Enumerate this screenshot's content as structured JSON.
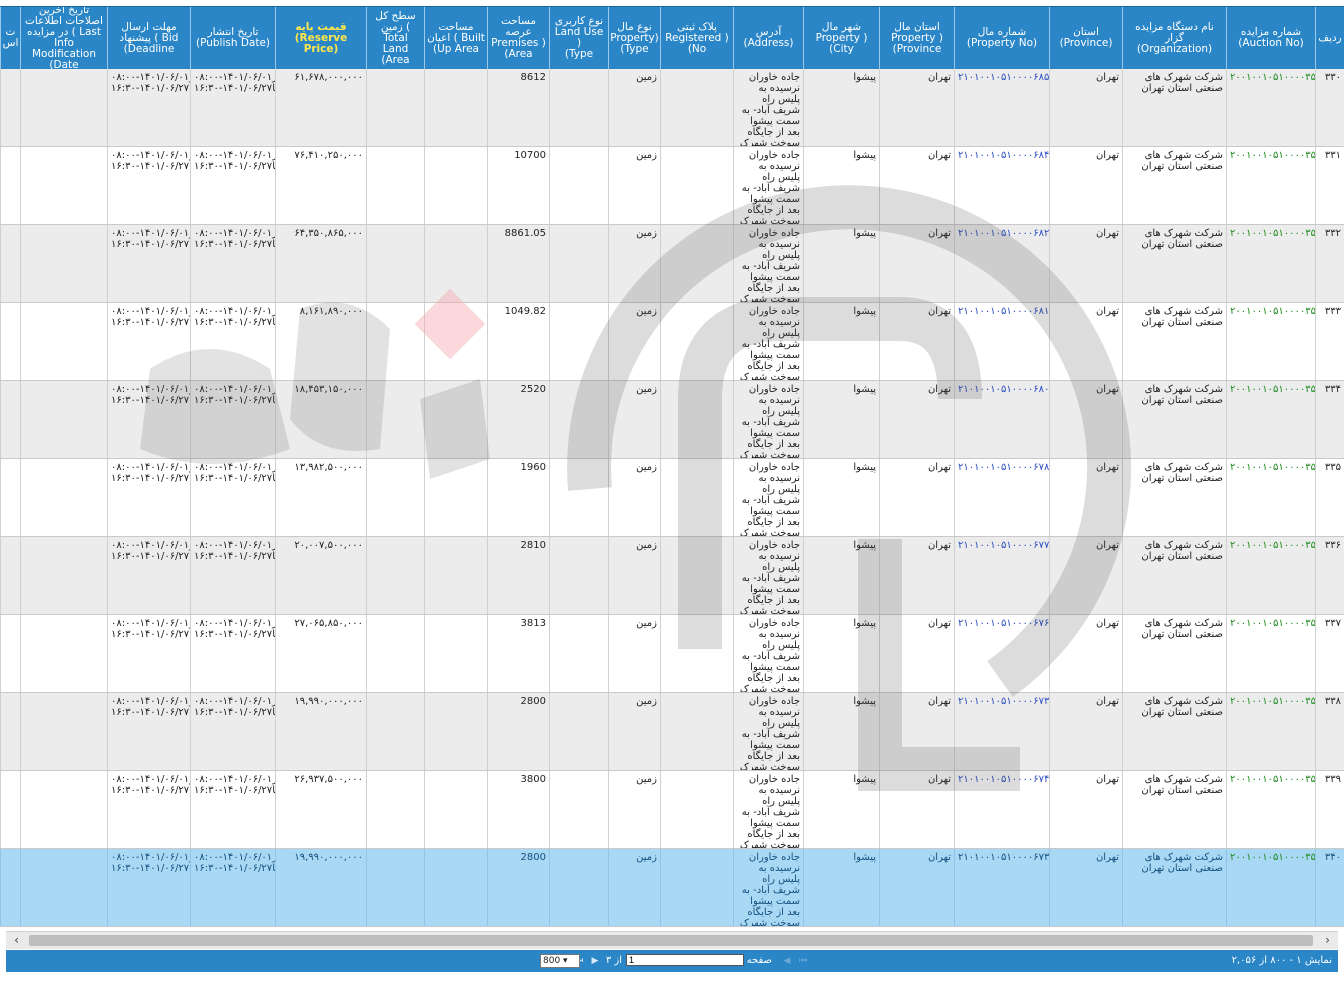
{
  "columns": [
    {
      "key": "row",
      "label": "ردیف"
    },
    {
      "key": "auction_no",
      "label": "شماره مزایده\n(Auction No)"
    },
    {
      "key": "organization",
      "label": "نام دستگاه مزایده گزار\n(Organization)"
    },
    {
      "key": "province",
      "label": "استان\n(Province)"
    },
    {
      "key": "property_no",
      "label": "شماره مال\n(Property No)"
    },
    {
      "key": "property_province",
      "label": "استان مال\nProperty )\n(Province"
    },
    {
      "key": "property_city",
      "label": "شهر مال\nProperty )\n(City"
    },
    {
      "key": "address",
      "label": "آدرس\n(Address)"
    },
    {
      "key": "registered_no",
      "label": "پلاک ثبتی\nRegistered )\n(No"
    },
    {
      "key": "property_type",
      "label": "نوع مال\nProperty)\n(Type"
    },
    {
      "key": "land_use_type",
      "label": "نوع کاربری\nLand Use )\n(Type"
    },
    {
      "key": "premises_area",
      "label": "مساحت\nعرصه\nPremises )\n(Area"
    },
    {
      "key": "built_up_area",
      "label": "مساحت\nاعیان ( Built\n(Up Area"
    },
    {
      "key": "total_land_area",
      "label": "سطح کل\nزمین ( Total\nLand\n(Area"
    },
    {
      "key": "reserve_price",
      "label": "قیمت پایه\n(Reserve Price)"
    },
    {
      "key": "publish_date",
      "label": "تاریخ انتشار\n(Publish Date)"
    },
    {
      "key": "bid_deadline",
      "label": "مهلت ارسال\nپیشنهاد ( Bid\n(Deadline"
    },
    {
      "key": "last_modification",
      "label": "تاریخ آخرین\nاصلاحات اطلاعات\nدر مزایده ( Last\nInfo\nModification\n(Date"
    },
    {
      "key": "extra",
      "label": "ت\nاس"
    }
  ],
  "common": {
    "auction_no": "۲۰۰۱۰۰۱۰۵۱۰۰۰۰۳۵",
    "organization": "شرکت شهرک های صنعتی استان تهران",
    "province": "تهران",
    "property_province": "تهران",
    "property_city": "پیشوا",
    "property_type": "زمین",
    "publish_date": "از۱۴۰۱/۰۶/۰۱-۰۸:۰۰\nتا۱۴۰۱/۰۶/۲۷-۱۶:۳۰",
    "bid_deadline": "از۱۴۰۱/۰۶/۰۱-۰۸:۰۰\nتا۱۴۰۱/۰۶/۲۷-۱۶:۳۰"
  },
  "rows": [
    {
      "row": "۳۳۰",
      "property_no": "۲۱۰۱۰۰۱۰۵۱۰۰۰۰۶۸۵",
      "address": "جاده خاوران نرسیده به پلیس راه شریف آباد- به سمت پیشوا بعد از جایگاه سوخت شهرک صنعتی پیشوا",
      "premises_area": "8612",
      "reserve_price": "۶۱,۶۷۸,۰۰۰,۰۰۰",
      "selected": false
    },
    {
      "row": "۳۳۱",
      "property_no": "۲۱۰۱۰۰۱۰۵۱۰۰۰۰۶۸۴",
      "address": "جاده خاوران نرسیده به پلیس راه شریف آباد- به سمت پیشوا بعد از جایگاه سوخت شهرک صنعتی پیشوا",
      "premises_area": "10700",
      "reserve_price": "۷۶,۴۱۰,۲۵۰,۰۰۰",
      "selected": false
    },
    {
      "row": "۳۳۲",
      "property_no": "۲۱۰۱۰۰۱۰۵۱۰۰۰۰۶۸۲",
      "address": "جاده خاوران نرسیده به پلیس راه شریف آباد- به سمت پیشوا بعد از جایگاه سوخت شهرک صنعتی پیشوا",
      "premises_area": "8861.05",
      "reserve_price": "۶۴,۳۵۰,۸۶۵,۰۰۰",
      "selected": false
    },
    {
      "row": "۳۳۳",
      "property_no": "۲۱۰۱۰۰۱۰۵۱۰۰۰۰۶۸۱",
      "address": "جاده خاوران نرسیده به پلیس راه شریف آباد- به سمت پیشوا بعد از جایگاه سوخت شهرک صنعتی پیشوا",
      "premises_area": "1049.82",
      "reserve_price": "۸,۱۶۱,۸۹۰,۰۰۰",
      "selected": false
    },
    {
      "row": "۳۳۴",
      "property_no": "۲۱۰۱۰۰۱۰۵۱۰۰۰۰۶۸۰",
      "address": "جاده خاوران نرسیده به پلیس راه شریف آباد- به سمت پیشوا بعد از جایگاه سوخت شهرک صنعتی پیشوا",
      "premises_area": "2520",
      "reserve_price": "۱۸,۴۵۳,۱۵۰,۰۰۰",
      "selected": false
    },
    {
      "row": "۳۳۵",
      "property_no": "۲۱۰۱۰۰۱۰۵۱۰۰۰۰۶۷۸",
      "address": "جاده خاوران نرسیده به پلیس راه شریف آباد- به سمت پیشوا بعد از جایگاه سوخت شهرک صنعتی پیشوا",
      "premises_area": "1960",
      "reserve_price": "۱۳,۹۸۲,۵۰۰,۰۰۰",
      "selected": false
    },
    {
      "row": "۳۳۶",
      "property_no": "۲۱۰۱۰۰۱۰۵۱۰۰۰۰۶۷۷",
      "address": "جاده خاوران نرسیده به پلیس راه شریف آباد- به سمت پیشوا بعد از جایگاه سوخت شهرک صنعتی پیشوا",
      "premises_area": "2810",
      "reserve_price": "۲۰,۰۰۷,۵۰۰,۰۰۰",
      "selected": false
    },
    {
      "row": "۳۳۷",
      "property_no": "۲۱۰۱۰۰۱۰۵۱۰۰۰۰۶۷۶",
      "address": "جاده خاوران نرسیده به پلیس راه شریف آباد- به سمت پیشوا بعد از جایگاه سوخت شهرک صنعتی پیشوا",
      "premises_area": "3813",
      "reserve_price": "۲۷,۰۶۵,۸۵۰,۰۰۰",
      "selected": false
    },
    {
      "row": "۳۳۸",
      "property_no": "۲۱۰۱۰۰۱۰۵۱۰۰۰۰۶۷۳",
      "address": "جاده خاوران نرسیده به پلیس راه شریف آباد- به سمت پیشوا بعد از جایگاه سوخت شهرک صنعتی پیشوا",
      "premises_area": "2800",
      "reserve_price": "۱۹,۹۹۰,۰۰۰,۰۰۰",
      "selected": false
    },
    {
      "row": "۳۳۹",
      "property_no": "۲۱۰۱۰۰۱۰۵۱۰۰۰۰۶۷۴",
      "address": "جاده خاوران نرسیده به پلیس راه شریف آباد- به سمت پیشوا بعد از جایگاه سوخت شهرک صنعتی پیشوا",
      "premises_area": "3800",
      "reserve_price": "۲۶,۹۳۷,۵۰۰,۰۰۰",
      "selected": false
    },
    {
      "row": "۳۴۰",
      "property_no": "۲۱۰۱۰۰۱۰۵۱۰۰۰۰۶۷۳",
      "address": "جاده خاوران نرسیده به پلیس راه شریف آباد- به سمت پیشوا بعد از جایگاه سوخت شهرک صنعتی پیشوا",
      "premises_area": "2800",
      "reserve_price": "۱۹,۹۹۰,۰۰۰,۰۰۰",
      "selected": true
    }
  ],
  "footer": {
    "summary": "نمایش ۱ - ۸۰۰ از ۲,۰۵۶",
    "page_label": "صفحه",
    "page_value": "1",
    "of_pages": "از ۳",
    "page_size": "800",
    "icons": {
      "first": "first-page-icon",
      "prev": "prev-page-icon",
      "next": "next-page-icon",
      "last": "last-page-icon"
    }
  },
  "colors": {
    "header_bg": "#2a86c7",
    "highlight_header": "#ffe84a",
    "auction_no": "#1f8b1f",
    "property_no": "#2a4fc4",
    "selected_row": "#a8d8f4"
  }
}
